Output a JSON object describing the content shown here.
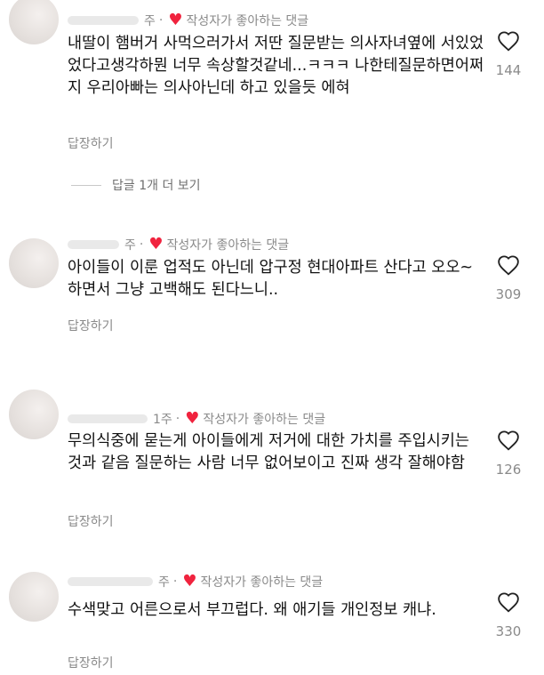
{
  "comments": [
    {
      "time": "주",
      "liked_label": "작성자가 좋아하는 댓글",
      "text": "내딸이 햄버거 사먹으러가서 저딴 질문받는 의사자녀옆에 서있었었다고생각하뭔 너무 속상할것같네...ㅋㅋㅋ 나한테질문하면어쩌지 우리아빠는 의사아닌데 하고 있을듯 에혀",
      "reply_label": "답장하기",
      "like_count": "144"
    },
    {
      "time": "주",
      "liked_label": "작성자가 좋아하는 댓글",
      "text": "아이들이 이룬 업적도 아닌데 압구정 현대아파트 산다고 오오~ 하면서 그냥 고백해도 된다느니..",
      "reply_label": "답장하기",
      "like_count": "309"
    },
    {
      "time": "1주",
      "liked_label": "작성자가 좋아하는 댓글",
      "text": "무의식중에 묻는게 아이들에게 저거에 대한 가치를 주입시키는 것과 같음 질문하는 사람 너무 없어보이고 진짜 생각 잘해야함",
      "reply_label": "답장하기",
      "like_count": "126"
    },
    {
      "time": "주",
      "liked_label": "작성자가 좋아하는 댓글",
      "text": "수색맞고 어른으로서 부끄럽다. 왜 애기들 개인정보 캐냐.",
      "reply_label": "답장하기",
      "like_count": "330"
    }
  ],
  "view_replies_label": "답글 1개 더 보기",
  "colors": {
    "heart_liked": "#f0233e",
    "muted": "#8a8a8a",
    "text": "#111111"
  },
  "icons": {
    "liked_by_author": "heart-filled-icon",
    "like": "heart-outline-icon"
  }
}
